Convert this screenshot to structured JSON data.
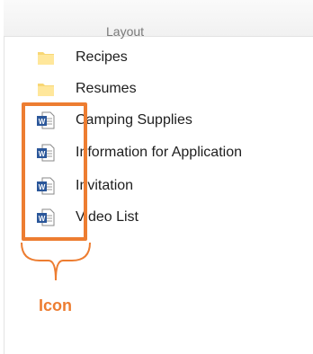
{
  "header": {
    "column_label": "Layout"
  },
  "files": [
    {
      "name": "Recipes",
      "type": "folder",
      "icon": "folder-icon"
    },
    {
      "name": "Resumes",
      "type": "folder",
      "icon": "folder-icon"
    },
    {
      "name": "Camping Supplies",
      "type": "document",
      "icon": "word-document-icon"
    },
    {
      "name": "Information for Application",
      "type": "document",
      "icon": "word-document-icon"
    },
    {
      "name": "Invitation",
      "type": "document",
      "icon": "word-document-icon"
    },
    {
      "name": "Video List",
      "type": "document",
      "icon": "word-document-icon"
    }
  ],
  "callout": {
    "label": "Icon",
    "color": "#ed7d31"
  }
}
